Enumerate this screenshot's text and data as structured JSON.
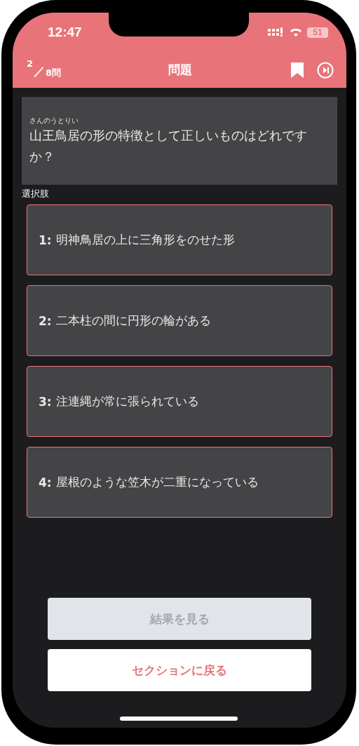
{
  "status_bar": {
    "time": "12:47",
    "battery": "51"
  },
  "header": {
    "progress": {
      "current": "2",
      "separator": "／",
      "total": "8問"
    },
    "title": "問題"
  },
  "question": {
    "ruby": "さんのうとりい",
    "text": "山王鳥居の形の特徴として正しいものはどれですか？"
  },
  "choices_label": "選択肢",
  "choices": [
    {
      "number": "1:",
      "text": "明神鳥居の上に三角形をのせた形",
      "selected": false
    },
    {
      "number": "2:",
      "text": "二本柱の間に円形の輪がある",
      "selected": false
    },
    {
      "number": "3:",
      "text": "注連縄が常に張られている",
      "selected": false
    },
    {
      "number": "4:",
      "text": "屋根のような笠木が二重になっている",
      "selected": false
    }
  ],
  "buttons": [
    {
      "label": "結果を見る",
      "disabled": true
    },
    {
      "label": "セクションに戻る",
      "disabled": false
    }
  ]
}
